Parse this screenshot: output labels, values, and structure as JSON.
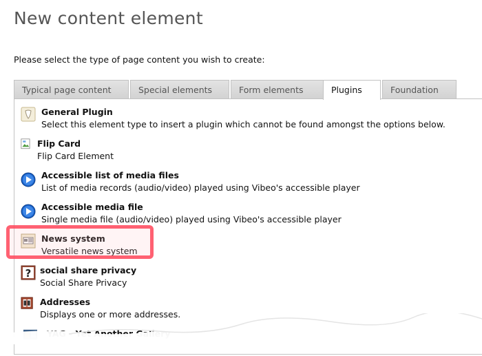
{
  "page": {
    "title": "New content element",
    "instruction": "Please select the type of page content you wish to create:"
  },
  "tabs": [
    {
      "label": "Typical page content",
      "active": false
    },
    {
      "label": "Special elements",
      "active": false
    },
    {
      "label": "Form elements",
      "active": false
    },
    {
      "label": "Plugins",
      "active": true
    },
    {
      "label": "Foundation",
      "active": false
    }
  ],
  "items": [
    {
      "title": "General Plugin",
      "desc": "Select this element type to insert a plugin which cannot be found amongst the options below.",
      "icon": "typo3-plugin-icon"
    },
    {
      "title": "Flip Card",
      "desc": "Flip Card Element",
      "icon": "broken-image-icon"
    },
    {
      "title": "Accessible list of media files",
      "desc": "List of media records (audio/video) played using Vibeo's accessible player",
      "icon": "play-icon"
    },
    {
      "title": "Accessible media file",
      "desc": "Single media file (audio/video) played using Vibeo's accessible player",
      "icon": "play-icon"
    },
    {
      "title": "News system",
      "desc": "Versatile news system",
      "icon": "news-icon"
    },
    {
      "title": "social share privacy",
      "desc": "Social Share Privacy",
      "icon": "question-icon"
    },
    {
      "title": "Addresses",
      "desc": "Displays one or more addresses.",
      "icon": "address-book-icon"
    },
    {
      "title": "YAG - Yet Another Gallery",
      "desc": "",
      "icon": "gallery-icon"
    }
  ],
  "colors": {
    "highlight": "#ff4a5c",
    "play_blue": "#1a62c9"
  }
}
